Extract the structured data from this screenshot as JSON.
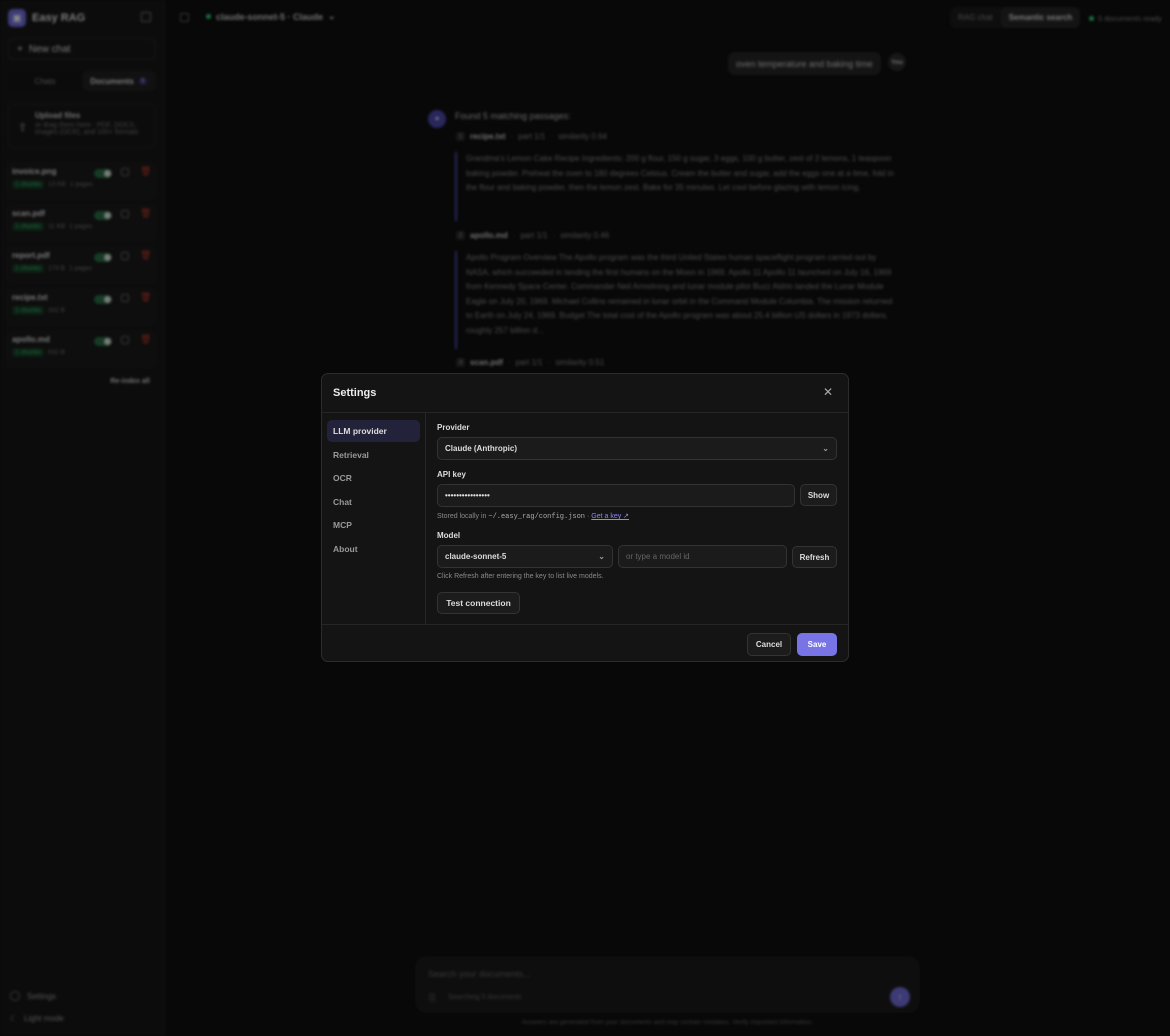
{
  "app": {
    "name": "Easy RAG",
    "new_chat": "New chat",
    "tabs": [
      {
        "label": "Chats"
      },
      {
        "label": "Documents",
        "count": "5"
      }
    ],
    "upload": {
      "title": "Upload files",
      "subtitle": "or drag them here · PDF, DOCX, images (OCR), and 100+ formats"
    },
    "documents": [
      {
        "name": "invoice.png",
        "chunks": "1 chunks",
        "size": "13 KB",
        "pages": "1 pages"
      },
      {
        "name": "scan.pdf",
        "chunks": "1 chunks",
        "size": "11 KB",
        "pages": "1 pages"
      },
      {
        "name": "report.pdf",
        "chunks": "1 chunks",
        "size": "174 B",
        "pages": "1 pages"
      },
      {
        "name": "recipe.txt",
        "chunks": "1 chunks",
        "size": "332 B",
        "pages": ""
      },
      {
        "name": "apollo.md",
        "chunks": "1 chunks",
        "size": "632 B",
        "pages": ""
      }
    ],
    "reindex_all": "Re-index all",
    "footer": {
      "settings": "Settings",
      "light_mode": "Light mode"
    }
  },
  "topbar": {
    "model": "claude-sonnet-5 · Claude",
    "modes": [
      "RAG chat",
      "Semantic search"
    ],
    "status": "5 documents ready"
  },
  "chat": {
    "user_message": "oven temperature and baking time",
    "user_avatar": "You",
    "found": "Found 5 matching passages:",
    "passages": [
      {
        "num": "1",
        "file": "recipe.txt",
        "part": "part 1/1",
        "similarity": "similarity 0.64",
        "text": "Grandma's Lemon Cake Recipe Ingredients: 200 g flour, 150 g sugar, 3 eggs, 100 g butter, zest of 2 lemons, 1 teaspoon baking powder. Preheat the oven to 180 degrees Celsius. Cream the butter and sugar, add the eggs one at a time, fold in the flour and baking powder, then the lemon zest. Bake for 35 minutes. Let cool before glazing with lemon icing."
      },
      {
        "num": "2",
        "file": "apollo.md",
        "part": "part 1/1",
        "similarity": "similarity 0.46",
        "text": "Apollo Program Overview The Apollo program was the third United States human spaceflight program carried out by NASA, which succeeded in landing the first humans on the Moon in 1969. Apollo 11 Apollo 11 launched on July 16, 1969 from Kennedy Space Center. Commander Neil Armstrong and lunar module pilot Buzz Aldrin landed the Lunar Module Eagle on July 20, 1969. Michael Collins remained in lunar orbit in the Command Module Columbia. The mission returned to Earth on July 24, 1969. Budget The total cost of the Apollo program was about 25.4 billion US dollars in 1973 dollars, roughly 257 billion d..."
      },
      {
        "num": "3",
        "file": "scan.pdf",
        "part": "part 1/1",
        "similarity": "similarity 0.51",
        "text": ""
      }
    ]
  },
  "composer": {
    "placeholder": "Search your documents...",
    "searching": "Searching 5 documents",
    "disclaimer": "Answers are generated from your documents and may contain mistakes. Verify important information."
  },
  "settings": {
    "title": "Settings",
    "nav": [
      "LLM provider",
      "Retrieval",
      "OCR",
      "Chat",
      "MCP",
      "About"
    ],
    "active_nav": "LLM provider",
    "provider_label": "Provider",
    "provider_value": "Claude (Anthropic)",
    "api_key_label": "API key",
    "api_key_value": "••••••••••••••••",
    "show_button": "Show",
    "stored_prefix": "Stored locally in",
    "stored_path": "~/.easy_rag/config.json",
    "stored_sep": "·",
    "get_key": "Get a key ↗",
    "model_label": "Model",
    "model_value": "claude-sonnet-5",
    "model_placeholder": "or type a model id",
    "refresh_button": "Refresh",
    "model_hint": "Click Refresh after entering the key to list live models.",
    "test_button": "Test connection",
    "cancel_button": "Cancel",
    "save_button": "Save"
  }
}
